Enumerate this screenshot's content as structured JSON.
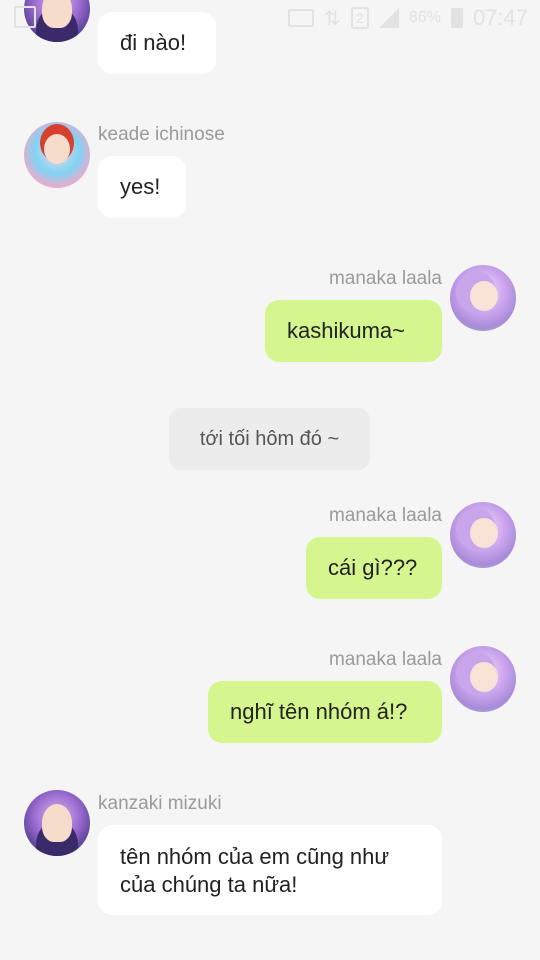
{
  "status_bar": {
    "sim_label": "2",
    "battery_percent": "86%",
    "time": "07:47"
  },
  "messages": [
    {
      "sender": "",
      "side": "left",
      "avatar": "kanzaki-mizuki-avatar",
      "text": "đi nào!"
    },
    {
      "sender": "keade ichinose",
      "side": "left",
      "avatar": "keade-ichinose-avatar",
      "text": "yes!"
    },
    {
      "sender": "manaka laala",
      "side": "right",
      "avatar": "manaka-laala-avatar",
      "text": "kashikuma~"
    },
    {
      "system": "tới tối hôm đó ~"
    },
    {
      "sender": "manaka laala",
      "side": "right",
      "avatar": "manaka-laala-avatar",
      "text": "cái gì???"
    },
    {
      "sender": "manaka laala",
      "side": "right",
      "avatar": "manaka-laala-avatar",
      "text": "nghĩ tên nhóm á!?"
    },
    {
      "sender": "kanzaki mizuki",
      "side": "left",
      "avatar": "kanzaki-mizuki-avatar",
      "text_line1": "tên nhóm của em cũng như",
      "text_line2": "của chúng ta nữa!"
    }
  ],
  "colors": {
    "background": "#f5f5f5",
    "incoming_bubble": "#ffffff",
    "outgoing_bubble": "#d5f58f",
    "system_bubble": "#ececec",
    "name_text": "#9a9a9a"
  }
}
